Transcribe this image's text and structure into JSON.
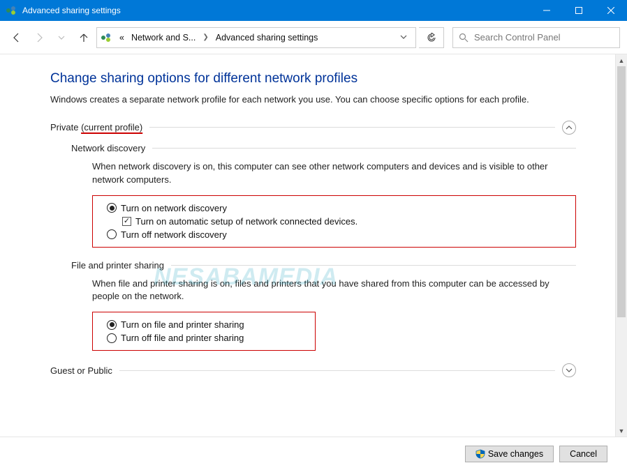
{
  "window": {
    "title": "Advanced sharing settings"
  },
  "breadcrumb": {
    "prefix": "«",
    "item1": "Network and S...",
    "item2": "Advanced sharing settings"
  },
  "search": {
    "placeholder": "Search Control Panel"
  },
  "page": {
    "title": "Change sharing options for different network profiles",
    "description": "Windows creates a separate network profile for each network you use. You can choose specific options for each profile."
  },
  "profiles": {
    "private": {
      "label": "Private",
      "current_suffix": "(current profile)",
      "sections": {
        "network_discovery": {
          "header": "Network discovery",
          "description": "When network discovery is on, this computer can see other network computers and devices and is visible to other network computers.",
          "options": {
            "on": "Turn on network discovery",
            "auto_setup": "Turn on automatic setup of network connected devices.",
            "off": "Turn off network discovery"
          }
        },
        "file_printer": {
          "header": "File and printer sharing",
          "description": "When file and printer sharing is on, files and printers that you have shared from this computer can be accessed by people on the network.",
          "options": {
            "on": "Turn on file and printer sharing",
            "off": "Turn off file and printer sharing"
          }
        }
      }
    },
    "guest": {
      "label": "Guest or Public"
    }
  },
  "footer": {
    "save": "Save changes",
    "cancel": "Cancel"
  },
  "watermark": "NESABAMEDIA"
}
